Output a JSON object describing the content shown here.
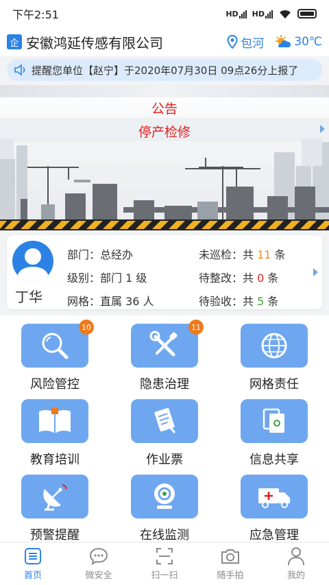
{
  "status_bar": {
    "time": "下午2:51",
    "signal1": "HD",
    "signal2": "HD"
  },
  "header": {
    "badge": "企",
    "company": "安徽鸿延传感有限公司",
    "location": "包河",
    "temperature": "30℃"
  },
  "notice": {
    "text": "提醒您单位【赵宁】于2020年07月30日 09点26分上报了"
  },
  "banner": {
    "title": "公告",
    "subtitle": "停产检修"
  },
  "profile": {
    "name": "丁华",
    "department_label": "部门：",
    "department": "总经办",
    "level_label": "级别：",
    "level": "部门 1 级",
    "grid_label": "网格：",
    "grid": "直属 36 人",
    "uninspected_label": "未巡检：共",
    "uninspected": "11",
    "unit": "条",
    "to_rectify_label": "待整改：共",
    "to_rectify": "0",
    "to_accept_label": "待验收：共",
    "to_accept": "5"
  },
  "menu": [
    {
      "label": "风险管控",
      "icon": "magnifier-icon",
      "badge": "10"
    },
    {
      "label": "隐患治理",
      "icon": "tools-icon",
      "badge": "11"
    },
    {
      "label": "网格责任",
      "icon": "globe-grid-icon"
    },
    {
      "label": "教育培训",
      "icon": "book-icon"
    },
    {
      "label": "作业票",
      "icon": "ticket-icon"
    },
    {
      "label": "信息共享",
      "icon": "share-docs-icon"
    },
    {
      "label": "预警提醒",
      "icon": "satellite-dish-icon"
    },
    {
      "label": "在线监测",
      "icon": "camera-monitor-icon"
    },
    {
      "label": "应急管理",
      "icon": "ambulance-icon"
    }
  ],
  "tabs": [
    {
      "label": "首页",
      "icon": "home-list-icon",
      "active": true
    },
    {
      "label": "微安全",
      "icon": "chat-bubble-icon"
    },
    {
      "label": "扫一扫",
      "icon": "scan-icon"
    },
    {
      "label": "随手拍",
      "icon": "camera-icon"
    },
    {
      "label": "我的",
      "icon": "person-icon"
    }
  ],
  "colors": {
    "accent": "#2b82e4",
    "tile": "#6ea7ef",
    "badge": "#f07a1a",
    "alert": "#e02020"
  }
}
